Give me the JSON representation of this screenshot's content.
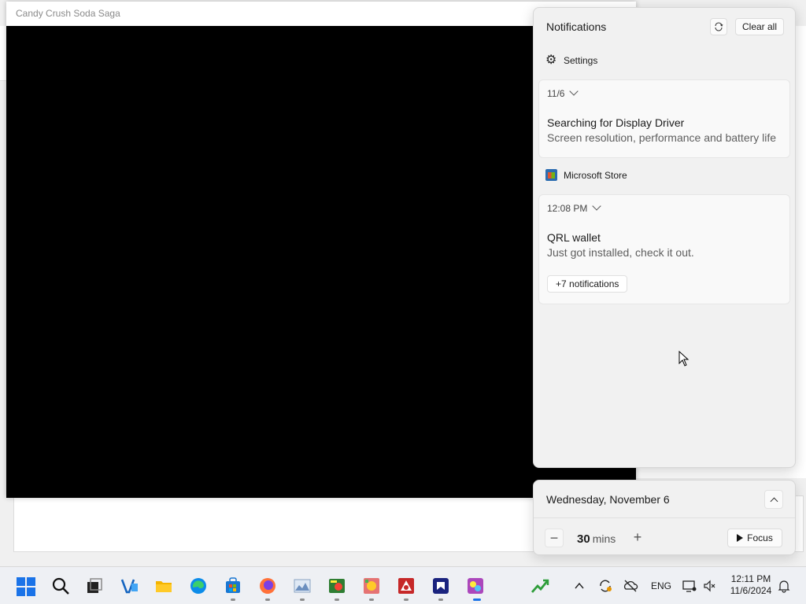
{
  "game_window": {
    "title": "Candy Crush Soda Saga"
  },
  "notifications": {
    "header": "Notifications",
    "clear_all_label": "Clear all",
    "groups": [
      {
        "app": "Settings",
        "time": "11/6",
        "title": "Searching for Display Driver",
        "body": "Screen resolution, performance and battery life"
      },
      {
        "app": "Microsoft Store",
        "time": "12:08 PM",
        "title": "QRL wallet",
        "body": "Just got installed, check it out.",
        "more_label": "+7 notifications"
      }
    ]
  },
  "focus": {
    "date": "Wednesday, November 6",
    "minutes": "30",
    "unit": "mins",
    "button_label": "Focus"
  },
  "taskbar": {
    "apps": [
      "start-icon",
      "search-icon",
      "task-view-icon",
      "vscode-like-icon",
      "file-explorer-icon",
      "edge-icon",
      "store-icon",
      "firefox-icon",
      "photo-viewer-icon",
      "game-icon",
      "candy-game-icon",
      "spider-game-icon",
      "app-icon",
      "candy-crush-soda-icon"
    ],
    "language": "ENG",
    "time": "12:11 PM",
    "date": "11/6/2024"
  }
}
